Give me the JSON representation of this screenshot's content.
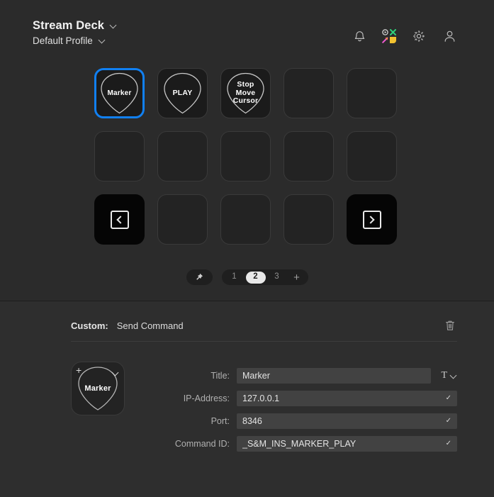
{
  "header": {
    "app_title": "Stream Deck",
    "profile_name": "Default Profile",
    "icons": {
      "notifications": "bell-icon",
      "store": "marketplace-icon",
      "settings": "gear-icon",
      "account": "user-icon"
    }
  },
  "grid": {
    "columns": 5,
    "rows": 3,
    "keys": [
      {
        "id": "r1c1",
        "type": "action",
        "label_lines": [
          "Marker"
        ],
        "selected": true,
        "shape": "pick"
      },
      {
        "id": "r1c2",
        "type": "action",
        "label_lines": [
          "PLAY"
        ],
        "selected": false,
        "shape": "pick"
      },
      {
        "id": "r1c3",
        "type": "action",
        "label_lines": [
          "Stop",
          "Move",
          "Cursor"
        ],
        "selected": false,
        "shape": "pick"
      },
      {
        "id": "r1c4",
        "type": "empty",
        "label_lines": [],
        "selected": false,
        "shape": "none"
      },
      {
        "id": "r1c5",
        "type": "empty",
        "label_lines": [],
        "selected": false,
        "shape": "none"
      },
      {
        "id": "r2c1",
        "type": "empty",
        "label_lines": [],
        "selected": false,
        "shape": "none"
      },
      {
        "id": "r2c2",
        "type": "empty",
        "label_lines": [],
        "selected": false,
        "shape": "none"
      },
      {
        "id": "r2c3",
        "type": "empty",
        "label_lines": [],
        "selected": false,
        "shape": "none"
      },
      {
        "id": "r2c4",
        "type": "empty",
        "label_lines": [],
        "selected": false,
        "shape": "none"
      },
      {
        "id": "r2c5",
        "type": "empty",
        "label_lines": [],
        "selected": false,
        "shape": "none"
      },
      {
        "id": "r3c1",
        "type": "nav-prev",
        "label_lines": [],
        "selected": false,
        "shape": "none"
      },
      {
        "id": "r3c2",
        "type": "empty",
        "label_lines": [],
        "selected": false,
        "shape": "none"
      },
      {
        "id": "r3c3",
        "type": "empty",
        "label_lines": [],
        "selected": false,
        "shape": "none"
      },
      {
        "id": "r3c4",
        "type": "empty",
        "label_lines": [],
        "selected": false,
        "shape": "none"
      },
      {
        "id": "r3c5",
        "type": "nav-next",
        "label_lines": [],
        "selected": false,
        "shape": "none"
      }
    ]
  },
  "pager": {
    "pin_icon": "pin-icon",
    "pages": [
      "1",
      "2",
      "3"
    ],
    "active_page": "2",
    "add_label": "+"
  },
  "action_bar": {
    "kind_label": "Custom:",
    "action_name": "Send Command",
    "delete_icon": "trash-icon"
  },
  "inspector": {
    "preview": {
      "label": "Marker",
      "add_label": "+",
      "menu_icon": "chevron-down-icon"
    },
    "fields": [
      {
        "key": "title",
        "label": "Title:",
        "value": "Marker",
        "placeholder": "",
        "has_check": false,
        "has_font_control": true
      },
      {
        "key": "ip",
        "label": "IP-Address:",
        "value": "127.0.0.1",
        "placeholder": "",
        "has_check": true,
        "has_font_control": false
      },
      {
        "key": "port",
        "label": "Port:",
        "value": "8346",
        "placeholder": "",
        "has_check": true,
        "has_font_control": false
      },
      {
        "key": "command_id",
        "label": "Command ID:",
        "value": "_S&M_INS_MARKER_PLAY",
        "placeholder": "",
        "has_check": true,
        "has_font_control": false
      }
    ],
    "font_control": {
      "glyph": "T",
      "chevron": "chevron-down-icon"
    },
    "check_glyph": "✓"
  },
  "colors": {
    "accent_selected": "#1180f2",
    "panel_top": "#2b2b2b",
    "panel_bottom": "#2e2e2e",
    "key_empty": "#232323",
    "key_nav": "#050505",
    "input_bg": "#424242"
  }
}
